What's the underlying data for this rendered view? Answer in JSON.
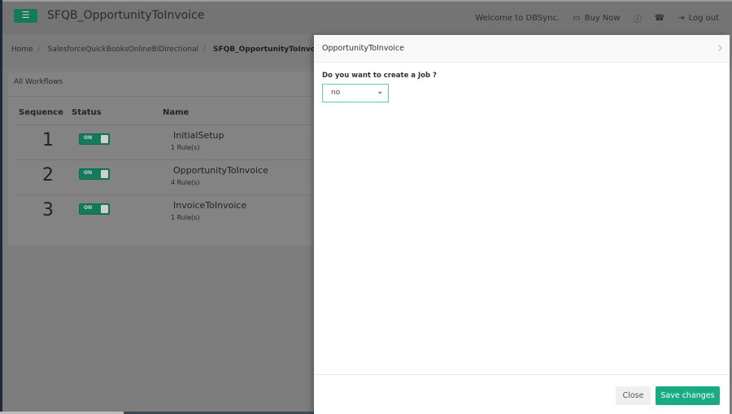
{
  "header": {
    "title": "SFQB_OpportunityToInvoice",
    "welcome": "Welcome to DBSync.",
    "buy_now": "Buy Now",
    "logout": "Log out"
  },
  "breadcrumb": [
    "Home",
    "SalesforceQuickBooksOnlineBiDirectional",
    "SFQB_OpportunityToInvoice"
  ],
  "workflows": {
    "title": "All Workflows",
    "columns": [
      "Sequence",
      "Status",
      "Name"
    ],
    "rows": [
      {
        "sequence": "1",
        "status": "ON",
        "name": "InitialSetup",
        "rules": "1 Rule(s)"
      },
      {
        "sequence": "2",
        "status": "ON",
        "name": "OpportunityToInvoice",
        "rules": "4 Rule(s)"
      },
      {
        "sequence": "3",
        "status": "ON",
        "name": "InvoiceToInvoice",
        "rules": "1 Rule(s)"
      }
    ]
  },
  "modal": {
    "title": "OpportunityToInvoice",
    "question": "Do you want to create a Job ?",
    "select_value": "no",
    "close": "Close",
    "save": "Save changes"
  },
  "colors": {
    "accent": "#1aaa84",
    "select_border": "#5fcfb0"
  }
}
